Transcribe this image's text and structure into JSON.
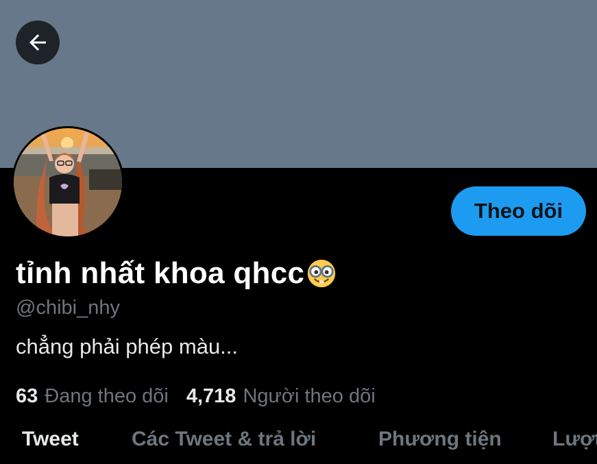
{
  "profile": {
    "display_name": "tỉnh nhất khoa qhcc",
    "name_emoji": "nerd-face",
    "handle": "@chibi_nhy",
    "bio": "chẳng phải phép màu...",
    "following_count": "63",
    "following_label": "Đang theo dõi",
    "followers_count": "4,718",
    "followers_label": "Người theo dõi"
  },
  "actions": {
    "follow_label": "Theo dõi",
    "back_icon": "arrow-left-icon"
  },
  "tabs": [
    {
      "label": "Tweet",
      "active": true
    },
    {
      "label": "Các Tweet & trả lời",
      "active": false
    },
    {
      "label": "Phương tiện",
      "active": false
    },
    {
      "label": "Lượt thích",
      "active": false
    }
  ],
  "colors": {
    "banner": "#66788a",
    "background": "#000000",
    "accent": "#1d9bf0",
    "secondary_text": "#6e767d"
  }
}
